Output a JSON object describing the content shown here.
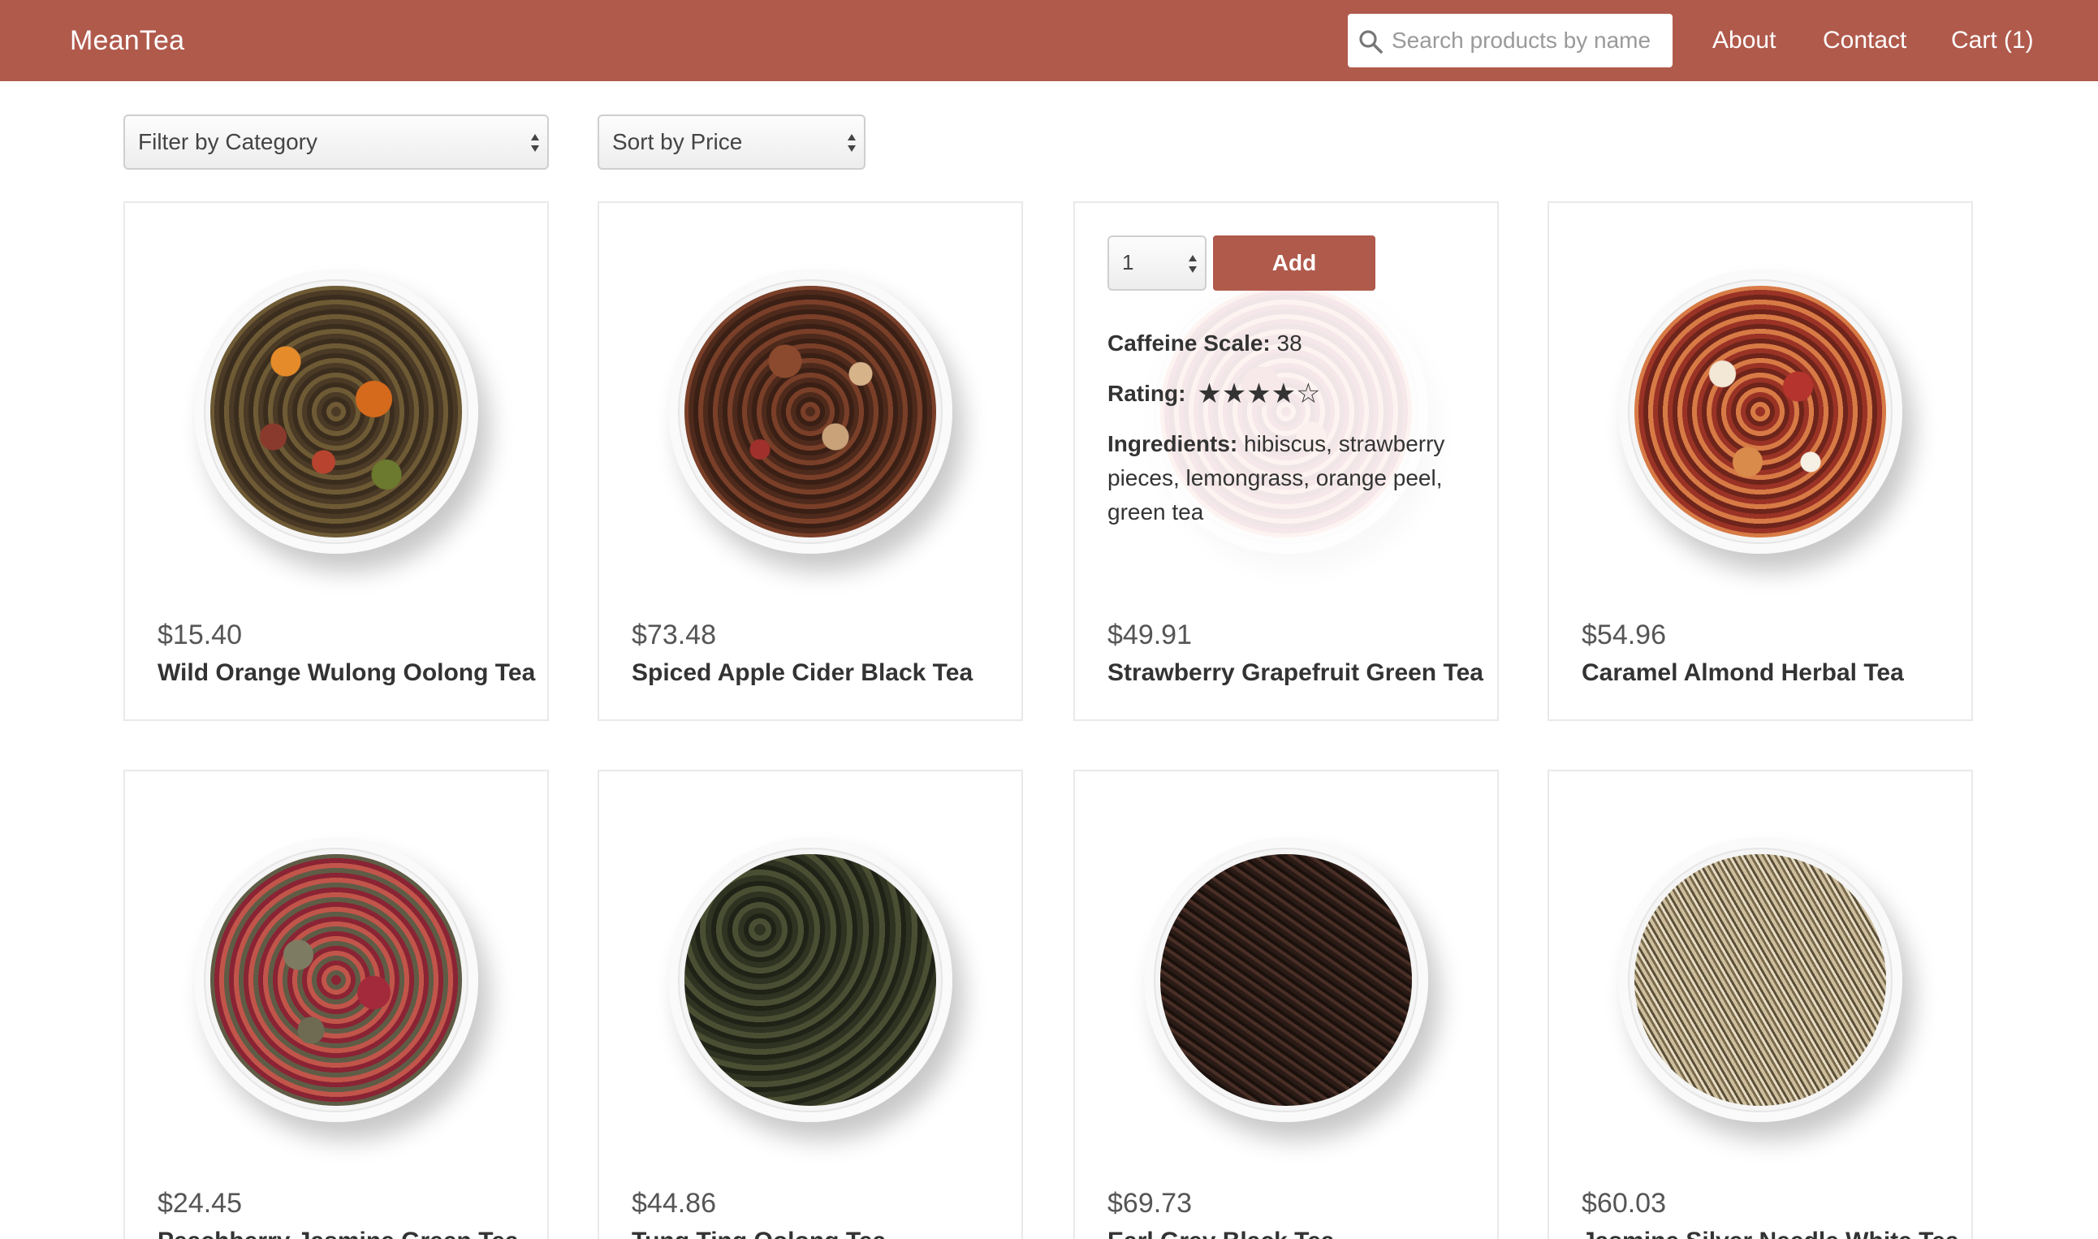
{
  "header": {
    "brand": "MeanTea",
    "search_placeholder": "Search products by name",
    "nav": {
      "about": "About",
      "contact": "Contact",
      "cart": "Cart (1)"
    },
    "bg_color": "#b05a4c"
  },
  "filters": {
    "category": "Filter by Category",
    "sort": "Sort by Price"
  },
  "products": [
    {
      "price": "$15.40",
      "name": "Wild Orange Wulong Oolong Tea"
    },
    {
      "price": "$73.48",
      "name": "Spiced Apple Cider Black Tea"
    },
    {
      "price": "$49.91",
      "name": "Strawberry Grapefruit Green Tea"
    },
    {
      "price": "$54.96",
      "name": "Caramel Almond Herbal Tea"
    },
    {
      "price": "$24.45",
      "name": "Peachberry Jasmine Green Tea"
    },
    {
      "price": "$44.86",
      "name": "Tung Ting Oolong Tea"
    },
    {
      "price": "$69.73",
      "name": "Earl Grey Black Tea"
    },
    {
      "price": "$60.03",
      "name": "Jasmine Silver Needle White Tea"
    }
  ],
  "hover_card": {
    "quantity": "1",
    "add_label": "Add",
    "caffeine_label": "Caffeine Scale:",
    "caffeine_value": "38",
    "rating_label": "Rating:",
    "rating_value": 4,
    "rating_max": 5,
    "ingredients_label": "Ingredients:",
    "ingredients_value": "hibiscus, strawberry pieces, lemongrass, orange peel, green tea"
  }
}
